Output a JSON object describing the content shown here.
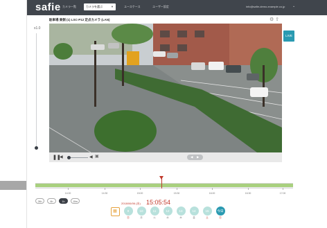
{
  "header": {
    "logo": "safie",
    "nav_camera_list": "カメラ一覧",
    "camera_select": "カメラを選ぶ",
    "nav_usecase": "ユースケース",
    "nav_settings": "ユーザー設定",
    "account": "info@safie-demo-example.co.jp"
  },
  "camera": {
    "title": "駐車場 東側 (1) LSC-P12 定点カメラ (LAN)",
    "zoom_label": "x1.0",
    "live_badge": "LIVE"
  },
  "timeline": {
    "ticks": [
      "14:00",
      "14:30",
      "15:00",
      "15:30",
      "16:00",
      "16:30",
      "17:00"
    ],
    "zoom_options": [
      "24h",
      "6h",
      "1h",
      "10m"
    ],
    "active_zoom": "1h",
    "current_date": "2018/06/06 (水)",
    "current_time": "15:05:54",
    "cursor_fraction": 0.49
  },
  "days": [
    {
      "num": "9",
      "wd": "日"
    },
    {
      "num": "10",
      "wd": "月"
    },
    {
      "num": "11",
      "wd": "火"
    },
    {
      "num": "12",
      "wd": "水"
    },
    {
      "num": "13",
      "wd": "木"
    },
    {
      "num": "14",
      "wd": "金"
    },
    {
      "num": "15",
      "wd": "土"
    },
    {
      "num": "今日",
      "wd": "日"
    }
  ],
  "colors": {
    "header_bg": "#40454c",
    "accent": "#2a9ab1",
    "timeline_bar": "#a8d07e",
    "time_red": "#c0392b"
  },
  "icons": {
    "pause": "pause-icon",
    "volume": "volume-icon",
    "speaker": "speaker-icon",
    "record": "record-icon",
    "calendar": "calendar-icon",
    "camera": "camera-icon",
    "settings": "settings-icon"
  }
}
